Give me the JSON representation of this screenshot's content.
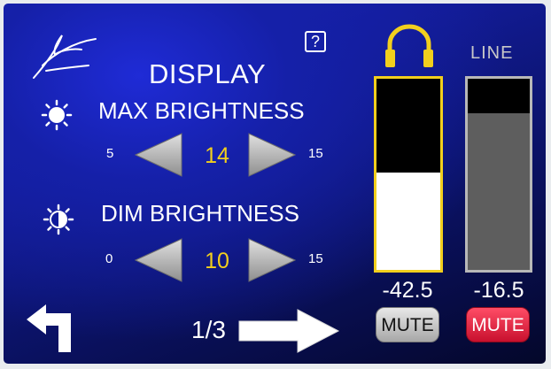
{
  "display": {
    "title": "DISPLAY",
    "help_label": "?",
    "max": {
      "label": "MAX BRIGHTNESS",
      "min": "5",
      "value": "14",
      "max": "15"
    },
    "dim": {
      "label": "DIM BRIGHTNESS",
      "min": "0",
      "value": "10",
      "max": "15"
    }
  },
  "meters": {
    "headphone": {
      "level_text": "-42.5",
      "fill_fraction": 0.51,
      "mute_label": "MUTE",
      "muted": false
    },
    "line": {
      "label": "LINE",
      "level_text": "-16.5",
      "fill_fraction": 0.82,
      "mute_label": "MUTE",
      "muted": true
    }
  },
  "nav": {
    "page": "1/3"
  },
  "icons": {
    "logo": "signature-logo-icon",
    "sun_full": "sun-icon",
    "sun_half": "half-sun-icon",
    "headphones": "headphones-icon",
    "back": "back-arrow-icon",
    "next": "next-arrow-icon",
    "decrease": "triangle-left-icon",
    "increase": "triangle-right-icon"
  },
  "colors": {
    "accent_yellow": "#f2cf1d",
    "mute_active_red": "#c8102e",
    "background_blue": "#1520a8"
  }
}
